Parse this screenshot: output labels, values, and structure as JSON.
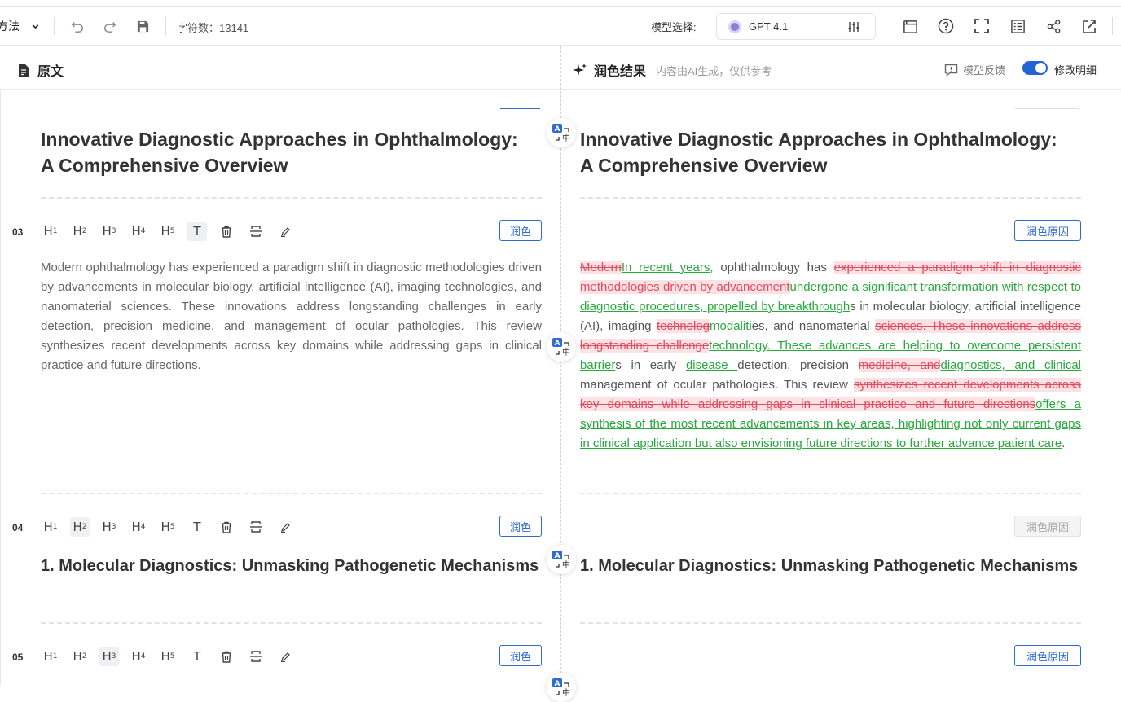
{
  "toolbar": {
    "mode_label": "方法",
    "char_count": "字符数：13141",
    "model_label": "模型选择:",
    "model_name": "GPT 4.1"
  },
  "header": {
    "left_title": "原文",
    "right_title": "润色结果",
    "right_subtitle": "内容由AI生成，仅供参考",
    "feedback_label": "模型反馈",
    "diff_label": "修改明细",
    "diff_toggle_on": true
  },
  "colors": {
    "accent": "#2f6bd3",
    "deleted": "#e34b5e",
    "deleted_bg": "#fde1e4",
    "inserted": "#27a93b"
  },
  "heading_buttons": [
    "H1",
    "H2",
    "H3",
    "H4",
    "H5"
  ],
  "text_button": "T",
  "doc": {
    "title_line1": "Innovative Diagnostic Approaches in Ophthalmology:",
    "title_line2": "A Comprehensive Overview",
    "rows": [
      {
        "num": "03",
        "active_heading": "T",
        "polish_label": "润色",
        "reason_label": "润色原因",
        "original": "Modern ophthalmology has experienced a paradigm shift in diagnostic methodologies driven by advancements in molecular biology, artificial intelligence (AI), imaging technologies, and nanomaterial sciences. These innovations address longstanding challenges in early detection, precision medicine, and management of ocular pathologies. This review synthesizes recent developments across key domains while addressing gaps in clinical practice and future directions.",
        "polished": [
          {
            "t": "del",
            "v": "Modern"
          },
          {
            "t": "ins",
            "v": "In recent years,"
          },
          {
            "t": "eq",
            "v": " ophthalmology has "
          },
          {
            "t": "del",
            "v": "experienced a paradigm shift in diagnostic methodologies driven by advancement"
          },
          {
            "t": "ins",
            "v": "undergone a significant transformation with respect to diagnostic procedures, propelled by breakthrough"
          },
          {
            "t": "eq",
            "v": "s in molecular biology, artificial intelligence (AI), imaging "
          },
          {
            "t": "del",
            "v": "technolog"
          },
          {
            "t": "ins",
            "v": "modaliti"
          },
          {
            "t": "eq",
            "v": "es, and nanomaterial "
          },
          {
            "t": "del",
            "v": "sciences. These innovations address longstanding challenge"
          },
          {
            "t": "ins",
            "v": "technology. These advances are helping to overcome persistent barrier"
          },
          {
            "t": "eq",
            "v": "s in early "
          },
          {
            "t": "ins",
            "v": "disease "
          },
          {
            "t": "eq",
            "v": "detection, precision "
          },
          {
            "t": "del",
            "v": "medicine, and"
          },
          {
            "t": "ins",
            "v": "diagnostics, and clinical"
          },
          {
            "t": "eq",
            "v": " management of ocular pathologies. This review "
          },
          {
            "t": "del",
            "v": "synthesizes recent developments across key domains while addressing gaps in clinical practice and future directions"
          },
          {
            "t": "ins",
            "v": "offers a synthesis of the most recent advancements in key areas, highlighting not only current gaps in clinical application but also envisioning future directions to further advance patient care"
          },
          {
            "t": "eq",
            "v": "."
          }
        ]
      },
      {
        "num": "04",
        "active_heading": "H2",
        "polish_label": "润色",
        "reason_label": "润色原因",
        "heading_text": "1. Molecular Diagnostics: Unmasking Pathogenetic Mechanisms"
      },
      {
        "num": "05",
        "active_heading": "H3",
        "polish_label": "润色",
        "reason_label": "润色原因"
      }
    ]
  }
}
